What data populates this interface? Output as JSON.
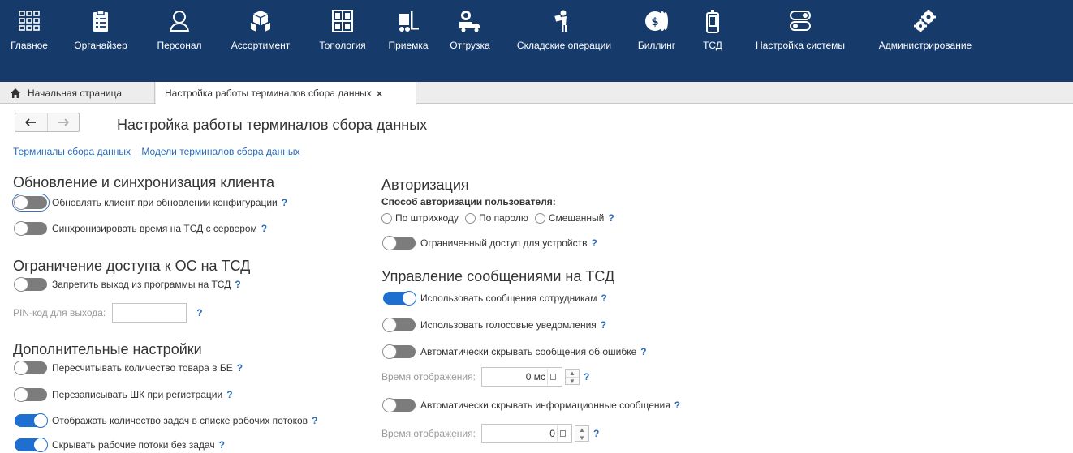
{
  "nav": {
    "items": [
      {
        "label": "Главное",
        "icon": "grid-icon"
      },
      {
        "label": "Органайзер",
        "icon": "clipboard-icon"
      },
      {
        "label": "Персонал",
        "icon": "person-icon"
      },
      {
        "label": "Ассортимент",
        "icon": "boxes-icon"
      },
      {
        "label": "Топология",
        "icon": "warehouse-icon"
      },
      {
        "label": "Приемка",
        "icon": "hand-truck-icon"
      },
      {
        "label": "Отгрузка",
        "icon": "delivery-truck-icon"
      },
      {
        "label": "Складские операции",
        "icon": "worker-icon"
      },
      {
        "label": "Биллинг",
        "icon": "coins-icon"
      },
      {
        "label": "ТСД",
        "icon": "handheld-terminal-icon"
      },
      {
        "label": "Настройка системы",
        "icon": "toggles-icon"
      },
      {
        "label": "Администрирование",
        "icon": "gears-icon"
      }
    ],
    "bg_color": "#163a6a"
  },
  "tabs": {
    "home_label": "Начальная страница",
    "active_label": "Настройка работы терминалов сбора данных",
    "close_symbol": "×"
  },
  "header": {
    "title": "Настройка работы терминалов сбора данных",
    "back_symbol": "←",
    "forward_symbol": "→"
  },
  "links": {
    "terminals": "Терминалы сбора данных",
    "models": "Модели терминалов сбора данных"
  },
  "help_symbol": "?",
  "sync": {
    "title": "Обновление и синхронизация клиента",
    "update_client": {
      "label": "Обновлять клиент при обновлении конфигурации",
      "on": false
    },
    "sync_time": {
      "label": "Синхронизировать время на ТСД с сервером",
      "on": false
    }
  },
  "os_access": {
    "title": "Ограничение доступа к ОС на ТСД",
    "forbid_exit": {
      "label": "Запретить выход из программы на ТСД",
      "on": false
    },
    "pin_label": "PIN-код для выхода:",
    "pin_value": ""
  },
  "additional": {
    "title": "Дополнительные настройки",
    "recount": {
      "label": "Пересчитывать количество товара в БЕ",
      "on": false
    },
    "rewrite_barcode": {
      "label": "Перезаписывать ШК при регистрации",
      "on": false
    },
    "show_task_count": {
      "label": "Отображать количество задач в списке рабочих потоков",
      "on": true
    },
    "hide_empty_flows": {
      "label": "Скрывать рабочие потоки без задач",
      "on": true
    }
  },
  "auth": {
    "title": "Авторизация",
    "method_label": "Способ авторизации пользователя:",
    "options": [
      "По штрихкоду",
      "По паролю",
      "Смешанный"
    ],
    "restricted_access": {
      "label": "Ограниченный доступ для устройств",
      "on": false
    }
  },
  "messages": {
    "title": "Управление сообщениями на ТСД",
    "use_employee_messages": {
      "label": "Использовать сообщения сотрудникам",
      "on": true
    },
    "use_voice": {
      "label": "Использовать голосовые уведомления",
      "on": false
    },
    "auto_hide_errors": {
      "label": "Автоматически скрывать сообщения об ошибке",
      "on": false
    },
    "display_time_label": "Время отображения:",
    "errors_time_value": "0 мс",
    "auto_hide_info": {
      "label": "Автоматически скрывать информационные сообщения",
      "on": false
    },
    "info_time_value": "0"
  }
}
